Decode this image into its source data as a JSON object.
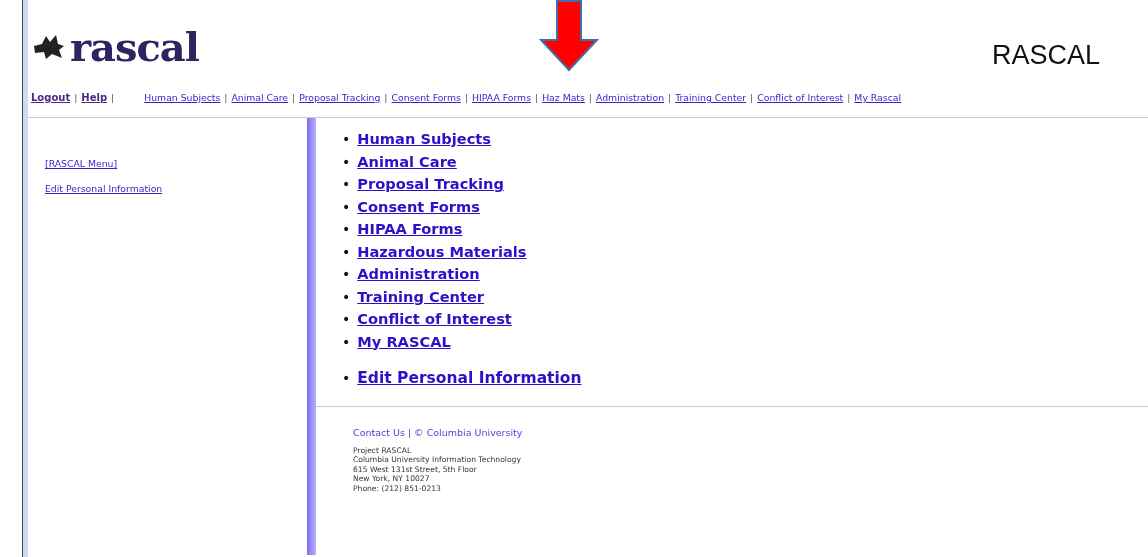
{
  "header": {
    "logo_text": "rascal",
    "title": "RASCAL"
  },
  "nav": [
    {
      "kind": "link",
      "label": "Logout",
      "bold": true
    },
    {
      "kind": "sep",
      "label": "|"
    },
    {
      "kind": "link",
      "label": "Help",
      "bold": true
    },
    {
      "kind": "sep",
      "label": "|"
    },
    {
      "kind": "gap"
    },
    {
      "kind": "link",
      "label": "Human Subjects",
      "bold": false
    },
    {
      "kind": "sep",
      "label": "|"
    },
    {
      "kind": "link",
      "label": "Animal Care",
      "bold": false
    },
    {
      "kind": "sep",
      "label": "|"
    },
    {
      "kind": "link",
      "label": "Proposal Tracking",
      "bold": false
    },
    {
      "kind": "sep",
      "label": "|"
    },
    {
      "kind": "link",
      "label": "Consent Forms",
      "bold": false
    },
    {
      "kind": "sep",
      "label": "|"
    },
    {
      "kind": "link",
      "label": "HIPAA Forms",
      "bold": false
    },
    {
      "kind": "sep",
      "label": "|"
    },
    {
      "kind": "link",
      "label": "Haz Mats",
      "bold": false
    },
    {
      "kind": "sep",
      "label": "|"
    },
    {
      "kind": "link",
      "label": "Administration",
      "bold": false
    },
    {
      "kind": "sep",
      "label": "|"
    },
    {
      "kind": "link",
      "label": "Training Center",
      "bold": false
    },
    {
      "kind": "sep",
      "label": "|"
    },
    {
      "kind": "link",
      "label": "Conflict of Interest",
      "bold": false
    },
    {
      "kind": "sep",
      "label": "|"
    },
    {
      "kind": "link",
      "label": "My Rascal",
      "bold": false
    }
  ],
  "sidebar": {
    "items": [
      "[RASCAL Menu]",
      "Edit Personal Information"
    ]
  },
  "menu": {
    "groups": [
      [
        {
          "bullet": "•",
          "label": "Human Subjects"
        },
        {
          "bullet": "•",
          "label": "Animal Care"
        },
        {
          "bullet": "•",
          "label": "Proposal Tracking"
        },
        {
          "bullet": "•",
          "label": "Consent Forms"
        },
        {
          "bullet": "•",
          "label": "HIPAA Forms"
        },
        {
          "bullet": "•",
          "label": "Hazardous Materials"
        },
        {
          "bullet": "•",
          "label": "Administration"
        },
        {
          "bullet": "•",
          "label": "Training Center"
        },
        {
          "bullet": "•",
          "label": "Conflict of Interest"
        },
        {
          "bullet": "•",
          "label": "My RASCAL"
        }
      ],
      [
        {
          "bullet": "•",
          "label": "Edit Personal Information"
        }
      ]
    ]
  },
  "footer": {
    "links": "Contact Us | © Columbia University",
    "address": [
      "Project RASCAL",
      "Columbia University Information Technology",
      "615 West 131st Street, 5th Floor",
      "New York, NY 10027",
      "Phone: (212) 851-0213"
    ]
  }
}
